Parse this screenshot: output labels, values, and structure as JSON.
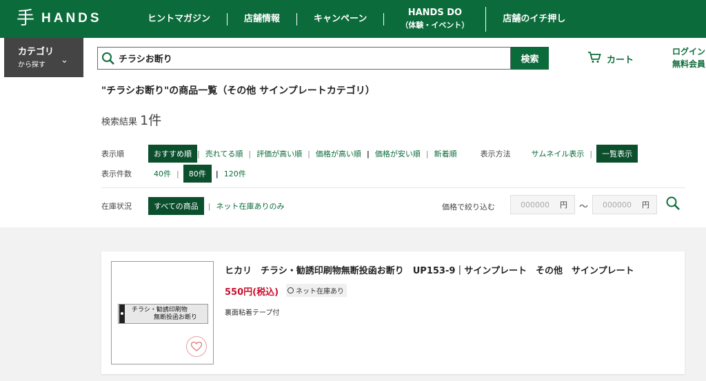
{
  "brand": {
    "mark": "手",
    "name": "HANDS"
  },
  "nav": [
    {
      "label": "ヒントマガジン",
      "sub": ""
    },
    {
      "label": "店舗情報",
      "sub": ""
    },
    {
      "label": "キャンペーン",
      "sub": ""
    },
    {
      "label": "HANDS DO",
      "sub": "（体験・イベント）"
    },
    {
      "label": "店舗のイチ押し",
      "sub": ""
    }
  ],
  "category": {
    "line1": "カテゴリ",
    "line2": "から探す"
  },
  "search": {
    "value": "チラシお断り",
    "button": "検索"
  },
  "cart": {
    "label": "カート"
  },
  "login": {
    "line1": "ログイン",
    "line2": "無料会員"
  },
  "results": {
    "heading": "\"チラシお断り\"の商品一覧（その他 サインプレートカテゴリ）",
    "count_label": "検索結果 ",
    "count": "1件"
  },
  "sort": {
    "label": "表示順",
    "options": [
      "おすすめ順",
      "売れてる順",
      "評価が高い順",
      "価格が高い順",
      "価格が安い順",
      "新着順"
    ],
    "selected": 0
  },
  "display": {
    "label": "表示方法",
    "options": [
      "サムネイル表示",
      "一覧表示"
    ],
    "selected": 1
  },
  "per_page": {
    "label": "表示件数",
    "options": [
      "40件",
      "80件",
      "120件"
    ],
    "selected": 1
  },
  "stock_filter": {
    "label": "在庫状況",
    "options": [
      "すべての商品",
      "ネット在庫ありのみ"
    ],
    "selected": 0
  },
  "price_filter": {
    "label": "価格で絞り込む",
    "min_placeholder": "000000",
    "max_placeholder": "000000",
    "unit": "円",
    "tilde": "〜"
  },
  "product": {
    "title": "ヒカリ　チラシ・勧誘印刷物無断投函お断り　UP153‐9｜サインプレート　その他　サインプレート",
    "price": "550円(税込)",
    "stock": "ネット在庫あり",
    "description": "裏面粘着テープ付",
    "image_text": [
      "チラシ・勧誘印刷物",
      "無断投函お断り"
    ]
  },
  "colors": {
    "brand_green": "#0b6b3a",
    "price_red": "#c8102e"
  }
}
